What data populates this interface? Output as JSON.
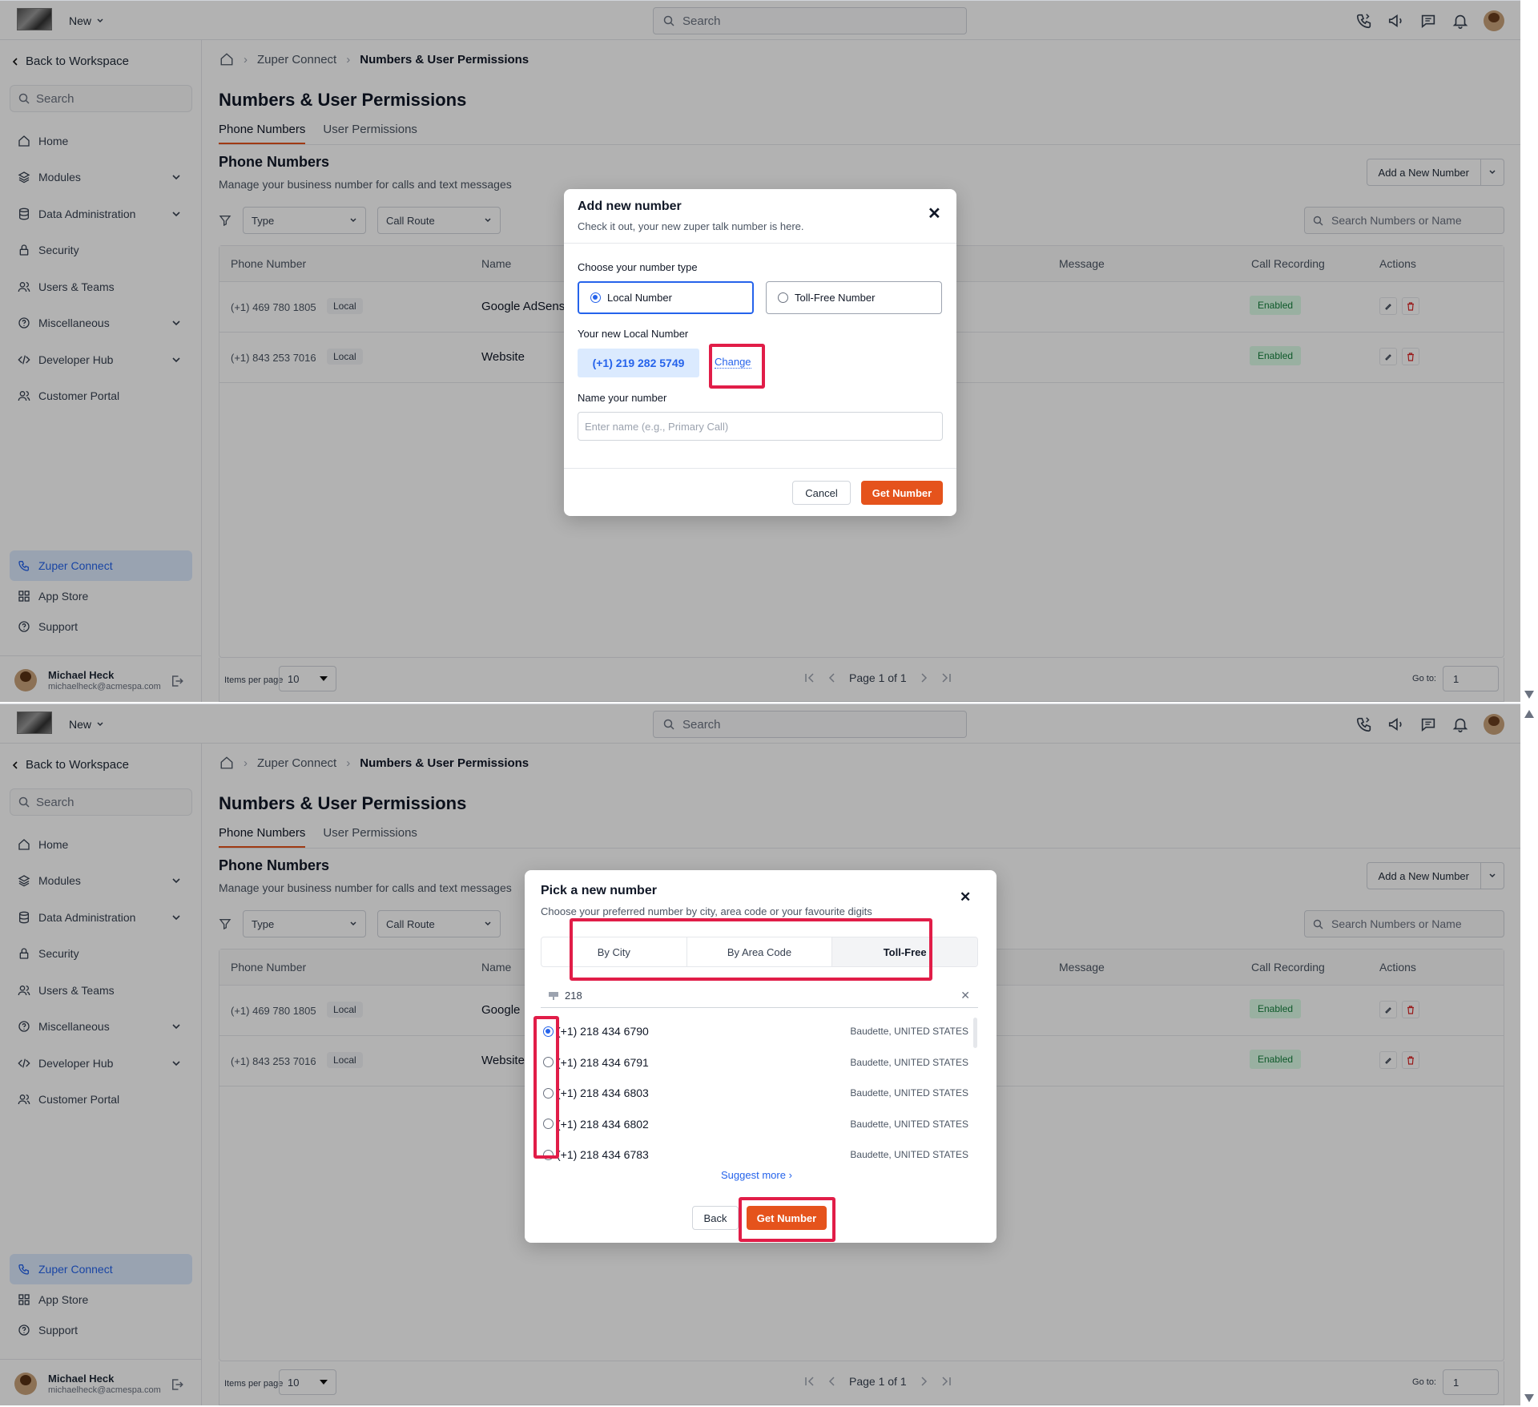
{
  "topbar": {
    "new_label": "New",
    "search_placeholder": "Search"
  },
  "sidebar": {
    "back_label": "Back to Workspace",
    "search_placeholder": "Search",
    "items": [
      {
        "label": "Home",
        "icon": "home-icon",
        "expandable": false
      },
      {
        "label": "Modules",
        "icon": "layers-icon",
        "expandable": true
      },
      {
        "label": "Data Administration",
        "icon": "database-icon",
        "expandable": true
      },
      {
        "label": "Security",
        "icon": "lock-icon",
        "expandable": false
      },
      {
        "label": "Users & Teams",
        "icon": "users-icon",
        "expandable": false
      },
      {
        "label": "Miscellaneous",
        "icon": "help-circle-icon",
        "expandable": true
      },
      {
        "label": "Developer Hub",
        "icon": "code-icon",
        "expandable": true
      },
      {
        "label": "Customer Portal",
        "icon": "users-icon",
        "expandable": false
      }
    ],
    "bottom": {
      "connect": "Zuper Connect",
      "app_store": "App Store",
      "support": "Support"
    },
    "user": {
      "name": "Michael Heck",
      "email": "michaelheck@acmespa.com"
    }
  },
  "main": {
    "breadcrumb": [
      "Zuper Connect",
      "Numbers & User Permissions"
    ],
    "title": "Numbers & User Permissions",
    "tabs": [
      "Phone Numbers",
      "User Permissions"
    ],
    "section_title": "Phone Numbers",
    "section_sub": "Manage your business number for calls and text messages",
    "add_button": "Add a New Number",
    "filters": {
      "type": "Type",
      "call_route": "Call Route"
    },
    "table_search_placeholder": "Search Numbers or Name",
    "columns": {
      "phone": "Phone Number",
      "name": "Name",
      "message": "Message",
      "recording": "Call Recording",
      "actions": "Actions"
    },
    "rows": [
      {
        "phone": "(+1) 469 780 1805",
        "type": "Local",
        "name": "Google AdSense",
        "name_p2": "Google",
        "recording": "Enabled"
      },
      {
        "phone": "(+1) 843 253 7016",
        "type": "Local",
        "name": "Website",
        "name_p2": "Website",
        "recording": "Enabled"
      }
    ],
    "pager": {
      "items_per_page": "Items per page",
      "per_page_value": "10",
      "page_text": "Page 1 of 1",
      "goto_label": "Go to:",
      "goto_value": "1"
    }
  },
  "modal1": {
    "title": "Add new number",
    "subtitle": "Check it out, your new zuper talk number is here.",
    "type_label": "Choose your number type",
    "options": [
      "Local Number",
      "Toll-Free Number"
    ],
    "selected_option": "Local Number",
    "new_number_label": "Your new Local Number",
    "new_number": "(+1) 219 282 5749",
    "change_link": "Change",
    "name_label": "Name your number",
    "name_placeholder": "Enter name (e.g., Primary Call)",
    "cancel": "Cancel",
    "get": "Get Number"
  },
  "modal2": {
    "title": "Pick a new number",
    "subtitle": "Choose your preferred number by city, area code or your favourite digits",
    "tabs": [
      "By City",
      "By Area Code",
      "Toll-Free"
    ],
    "active_tab": "Toll-Free",
    "search_value": "218",
    "numbers": [
      {
        "number": "(+1) 218 434 6790",
        "location": "Baudette, UNITED STATES",
        "selected": true
      },
      {
        "number": "(+1) 218 434 6791",
        "location": "Baudette, UNITED STATES",
        "selected": false
      },
      {
        "number": "(+1) 218 434 6803",
        "location": "Baudette, UNITED STATES",
        "selected": false
      },
      {
        "number": "(+1) 218 434 6802",
        "location": "Baudette, UNITED STATES",
        "selected": false
      },
      {
        "number": "(+1) 218 434 6783",
        "location": "Baudette, UNITED STATES",
        "selected": false
      }
    ],
    "suggest_more": "Suggest more",
    "back": "Back",
    "get": "Get Number"
  },
  "colors": {
    "accent": "#e5531c",
    "highlight": "#e11d48",
    "link": "#2563eb",
    "enabled_bg": "#dcfce7"
  }
}
